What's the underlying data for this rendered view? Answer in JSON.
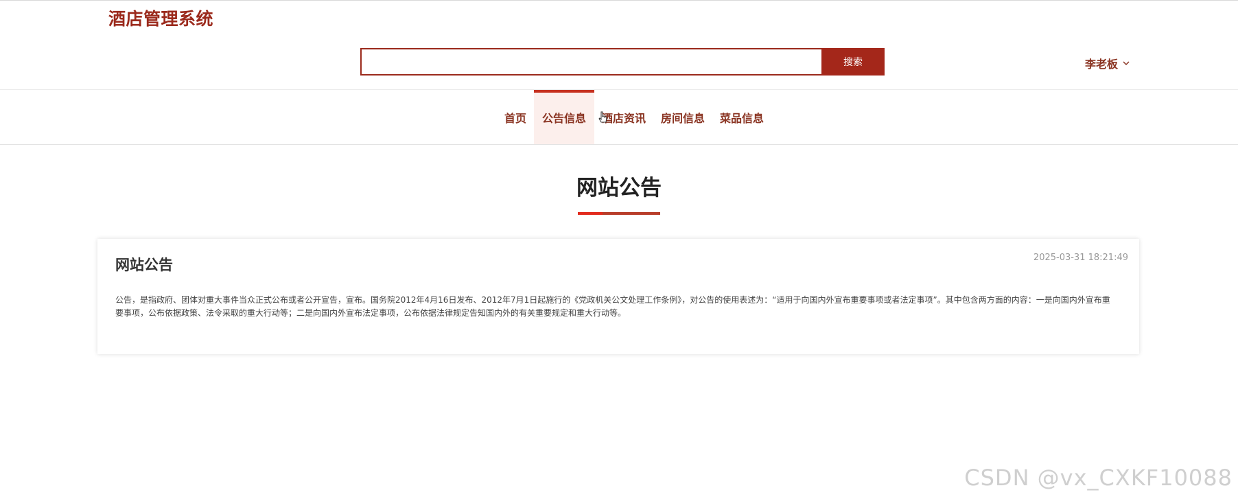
{
  "header": {
    "brand": "酒店管理系统",
    "search": {
      "value": "",
      "placeholder": "",
      "button_label": "搜索"
    },
    "user": {
      "name": "李老板"
    }
  },
  "nav": {
    "items": [
      {
        "label": "首页"
      },
      {
        "label": "公告信息",
        "active": true
      },
      {
        "label": "酒店资讯"
      },
      {
        "label": "房间信息"
      },
      {
        "label": "菜品信息"
      }
    ]
  },
  "page": {
    "title": "网站公告"
  },
  "notice": {
    "title": "网站公告",
    "date": "2025-03-31 18:21:49",
    "body": "公告，是指政府、团体对重大事件当众正式公布或者公开宣告，宣布。国务院2012年4月16日发布、2012年7月1日起施行的《党政机关公文处理工作条例》，对公告的使用表述为：“适用于向国内外宣布重要事项或者法定事项”。其中包含两方面的内容：一是向国内外宣布重要事项，公布依据政策、法令采取的重大行动等；二是向国内外宣布法定事项，公布依据法律规定告知国内外的有关重要规定和重大行动等。"
  },
  "watermark": "CSDN @vx_CXKF10088",
  "colors": {
    "brand": "#9b2a1c",
    "accent": "#c6301f",
    "active_bg": "#fcefec"
  }
}
